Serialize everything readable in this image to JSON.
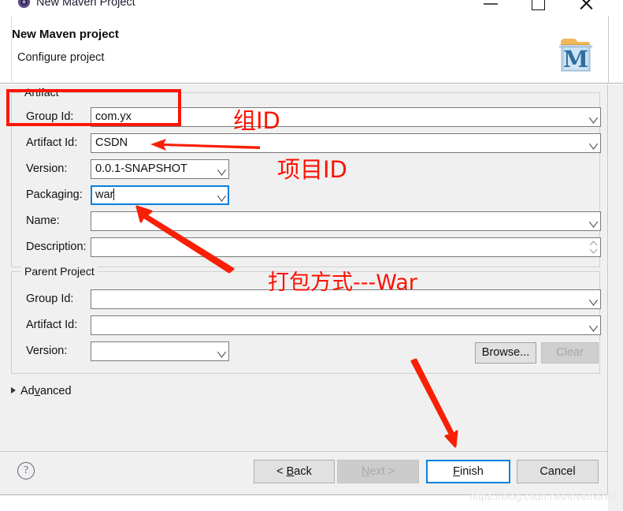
{
  "window": {
    "title": "New Maven Project",
    "icon": "maven-window-icon",
    "minimize_label": "Minimize",
    "maximize_label": "Maximize",
    "close_label": "Close"
  },
  "header": {
    "title": "New Maven project",
    "subtitle": "Configure project",
    "logo": "maven-m-logo"
  },
  "artifact": {
    "group_title": "Artifact",
    "fields": [
      {
        "label": "Group Id:",
        "value": "com.yx",
        "control": "combo",
        "state": "normal"
      },
      {
        "label": "Artifact Id:",
        "value": "CSDN",
        "control": "combo",
        "state": "normal"
      },
      {
        "label": "Version:",
        "value": "0.0.1-SNAPSHOT",
        "control": "combo-sm",
        "state": "normal"
      },
      {
        "label": "Packaging:",
        "value": "war",
        "control": "combo-sm",
        "state": "focused"
      },
      {
        "label": "Name:",
        "value": "",
        "control": "combo",
        "state": "normal"
      },
      {
        "label": "Description:",
        "value": "",
        "control": "textarea",
        "state": "normal"
      }
    ]
  },
  "parent": {
    "group_title": "Parent Project",
    "fields": [
      {
        "label": "Group Id:",
        "value": "",
        "control": "combo",
        "state": "normal"
      },
      {
        "label": "Artifact Id:",
        "value": "",
        "control": "combo",
        "state": "normal"
      },
      {
        "label": "Version:",
        "value": "",
        "control": "combo-sm",
        "state": "normal"
      }
    ],
    "browse_label": "Browse...",
    "clear_label": "Clear",
    "browse_enabled": true,
    "clear_enabled": false
  },
  "advanced": {
    "label_pre": "Ad",
    "label_mnemonic": "v",
    "label_post": "anced",
    "expanded": false,
    "arrow_icon": "triangle-right-icon"
  },
  "footer": {
    "help_icon": "question-mark-icon",
    "buttons": [
      {
        "id": "back",
        "pre": "< ",
        "mnemonic": "B",
        "post": "ack",
        "enabled": true,
        "default": false
      },
      {
        "id": "next",
        "pre": "",
        "mnemonic": "N",
        "post": "ext >",
        "enabled": false,
        "default": false
      },
      {
        "id": "finish",
        "pre": "",
        "mnemonic": "F",
        "post": "inish",
        "enabled": true,
        "default": true
      },
      {
        "id": "cancel",
        "pre": "",
        "mnemonic": "",
        "post": "Cancel",
        "enabled": true,
        "default": false
      }
    ],
    "watermark": "https://blog.csdn.net/lovemore2"
  },
  "annotations": {
    "group_id_box": "red-highlight-rectangle",
    "group_id_text": "组ID",
    "artifact_id_text": "项目ID",
    "packaging_text": "打包方式---War",
    "arrow_to_artifact_id": "red-arrow-left",
    "arrow_to_packaging": "red-arrow-up-left",
    "arrow_to_finish": "red-arrow-down-right",
    "color": "#fc1202"
  }
}
